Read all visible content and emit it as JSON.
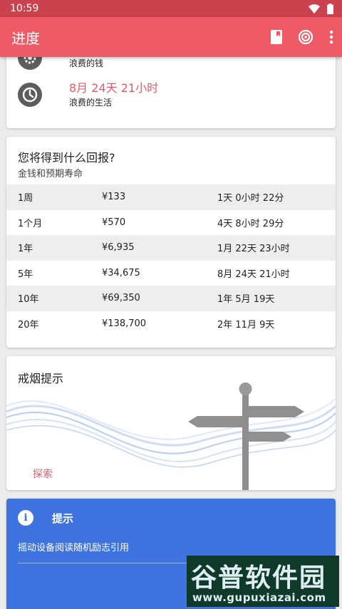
{
  "status_bar": {
    "time": "10:59"
  },
  "app_bar": {
    "title": "进度",
    "icons": [
      "book-icon",
      "target-icon",
      "more-vertical-icon"
    ]
  },
  "progress": {
    "money": {
      "label": "浪费的钱",
      "icon": "gear-icon"
    },
    "life": {
      "value": "8月 24天 21小时",
      "label": "浪费的生活",
      "icon": "clock-icon"
    }
  },
  "reward": {
    "title": "您将得到什么回报?",
    "subtitle": "金钱和预期寿命",
    "rows": [
      {
        "period": "1周",
        "money": "¥133",
        "time": "1天 0小时 22分"
      },
      {
        "period": "1个月",
        "money": "¥570",
        "time": "4天 8小时 29分"
      },
      {
        "period": "1年",
        "money": "¥6,935",
        "time": "1月 22天 23小时"
      },
      {
        "period": "5年",
        "money": "¥34,675",
        "time": "8月 24天 21小时"
      },
      {
        "period": "10年",
        "money": "¥69,350",
        "time": "1年 5月 19天"
      },
      {
        "period": "20年",
        "money": "¥138,700",
        "time": "2年 11月 9天"
      }
    ]
  },
  "tips": {
    "title": "戒烟提示",
    "explore_label": "探索",
    "illustration": "signpost-icon"
  },
  "hint": {
    "icon": "info-icon",
    "icon_glyph": "i",
    "title": "提示",
    "text": "摇动设备阅读随机励志引用"
  },
  "watermark": {
    "big": "谷普软件园",
    "small": "www.gupuxiazai.com"
  },
  "colors": {
    "status_bar": "#c9424e",
    "app_bar": "#ee5a66",
    "accent": "#e35a66",
    "hint_bg": "#3f74e0"
  }
}
